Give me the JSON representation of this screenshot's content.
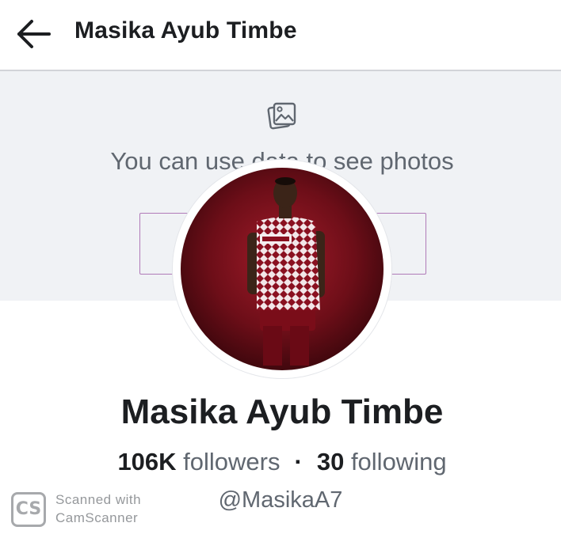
{
  "header": {
    "back_icon": "arrow-left-icon",
    "title": "Masika Ayub Timbe"
  },
  "cover": {
    "icon": "photos-icon",
    "text": "You can use data to see photos",
    "button_label": ""
  },
  "profile": {
    "avatar": "profile-photo",
    "name": "Masika Ayub Timbe",
    "followers_count": "106K",
    "followers_label": "followers",
    "separator": "·",
    "following_count": "30",
    "following_label": "following",
    "username": "@MasikaA7"
  },
  "watermark": {
    "logo_text": "CS",
    "line1": "Scanned with",
    "line2": "CamScanner"
  },
  "colors": {
    "header_bg": "#ffffff",
    "cover_bg": "#f0f2f5",
    "text_primary": "#1c1e21",
    "text_secondary": "#606770",
    "button_border": "#b07ab8",
    "avatar_bg": "#6b0f1a"
  }
}
